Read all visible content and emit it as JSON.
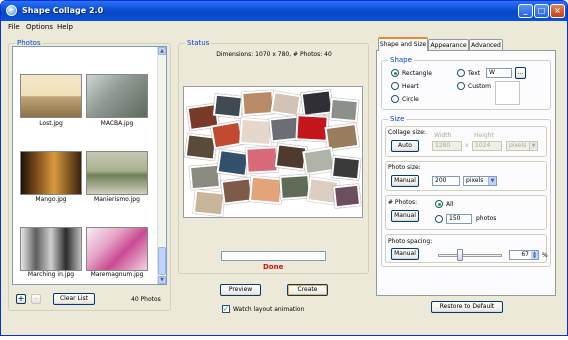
{
  "window": {
    "title": "Shape Collage 2.0"
  },
  "menu": [
    "File",
    "Options",
    "Help"
  ],
  "photos_panel": {
    "label": "Photos",
    "items": [
      "Lost.jpg",
      "MACBA.jpg",
      "Mango.jpg",
      "Manierismo.jpg",
      "Marching in.jpg",
      "Maremagnum.jpg"
    ],
    "add_symbol": "+",
    "remove_symbol": "-",
    "clear_button": "Clear List",
    "count_text": "40 Photos"
  },
  "status_panel": {
    "label": "Status",
    "dimensions_text": "Dimensions: 1070 x 780, # Photos: 40",
    "progress_fraction": 0,
    "done_text": "Done",
    "preview_button": "Preview",
    "create_button": "Create",
    "watch_animation_label": "Watch layout animation",
    "watch_animation_checked": true
  },
  "tabs": [
    "Shape and Size",
    "Appearance",
    "Advanced"
  ],
  "active_tab": "Shape and Size",
  "shape": {
    "label": "Shape",
    "options": [
      "Rectangle",
      "Heart",
      "Circle",
      "Text",
      "Custom"
    ],
    "selected": "Rectangle",
    "text_value": "W",
    "browse_button": "..."
  },
  "size": {
    "label": "Size",
    "collage_size_label": "Collage size:",
    "collage_mode_button": "Auto",
    "width_label": "Width",
    "height_label": "Height",
    "width_value": "1280",
    "height_value": "1024",
    "times_symbol": "x",
    "collage_unit": "pixels",
    "photo_size_label": "Photo size:",
    "photo_size_mode_button": "Manual",
    "photo_size_value": "200",
    "photo_size_unit": "pixels",
    "num_photos_label": "# Photos:",
    "num_photos_mode_button": "Manual",
    "num_photos_all_label": "All",
    "num_photos_value": "150",
    "num_photos_unit": "photos",
    "num_photos_selected": "All",
    "spacing_label": "Photo spacing:",
    "spacing_mode_button": "Manual",
    "spacing_value": "67",
    "spacing_unit": "%",
    "spacing_fraction": 0.33
  },
  "restore_button": "Restore to Default",
  "colors": {
    "titlebar": "#0a52dd",
    "group_label": "#0046d5",
    "done": "#d41212",
    "active_tab_accent": "#e68b2c"
  }
}
